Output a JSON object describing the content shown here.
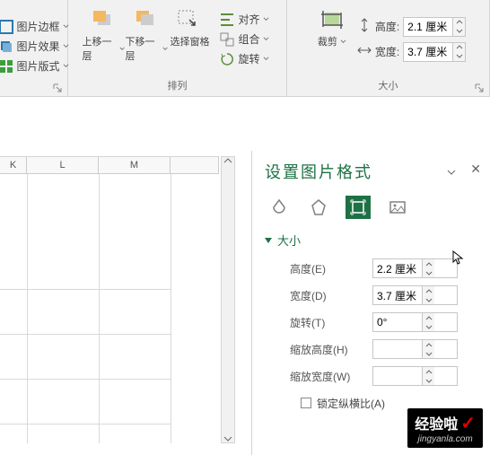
{
  "ribbon": {
    "group1": {
      "border": "图片边框",
      "effect": "图片效果",
      "layout": "图片版式"
    },
    "arrange": {
      "label": "排列",
      "forward": "上移一层",
      "backward": "下移一层",
      "selectPane": "选择窗格",
      "align": "对齐",
      "group": "组合",
      "rotate": "旋转"
    },
    "size": {
      "label": "大小",
      "crop": "裁剪",
      "heightLabel": "高度:",
      "widthLabel": "宽度:",
      "heightVal": "2.1 厘米",
      "widthVal": "3.7 厘米"
    }
  },
  "sheet": {
    "cols": [
      "K",
      "L",
      "M"
    ]
  },
  "pane": {
    "title": "设置图片格式",
    "section": "大小",
    "height": {
      "label": "高度(E)",
      "val": "2.2 厘米"
    },
    "width": {
      "label": "宽度(D)",
      "val": "3.7 厘米"
    },
    "rotate": {
      "label": "旋转(T)",
      "val": "0°"
    },
    "scaleH": {
      "label": "缩放高度(H)",
      "val": ""
    },
    "scaleW": {
      "label": "缩放宽度(W)",
      "val": ""
    },
    "lock": "锁定纵横比(A)"
  },
  "watermark": {
    "big": "经验啦",
    "small": "jingyanla.com"
  }
}
